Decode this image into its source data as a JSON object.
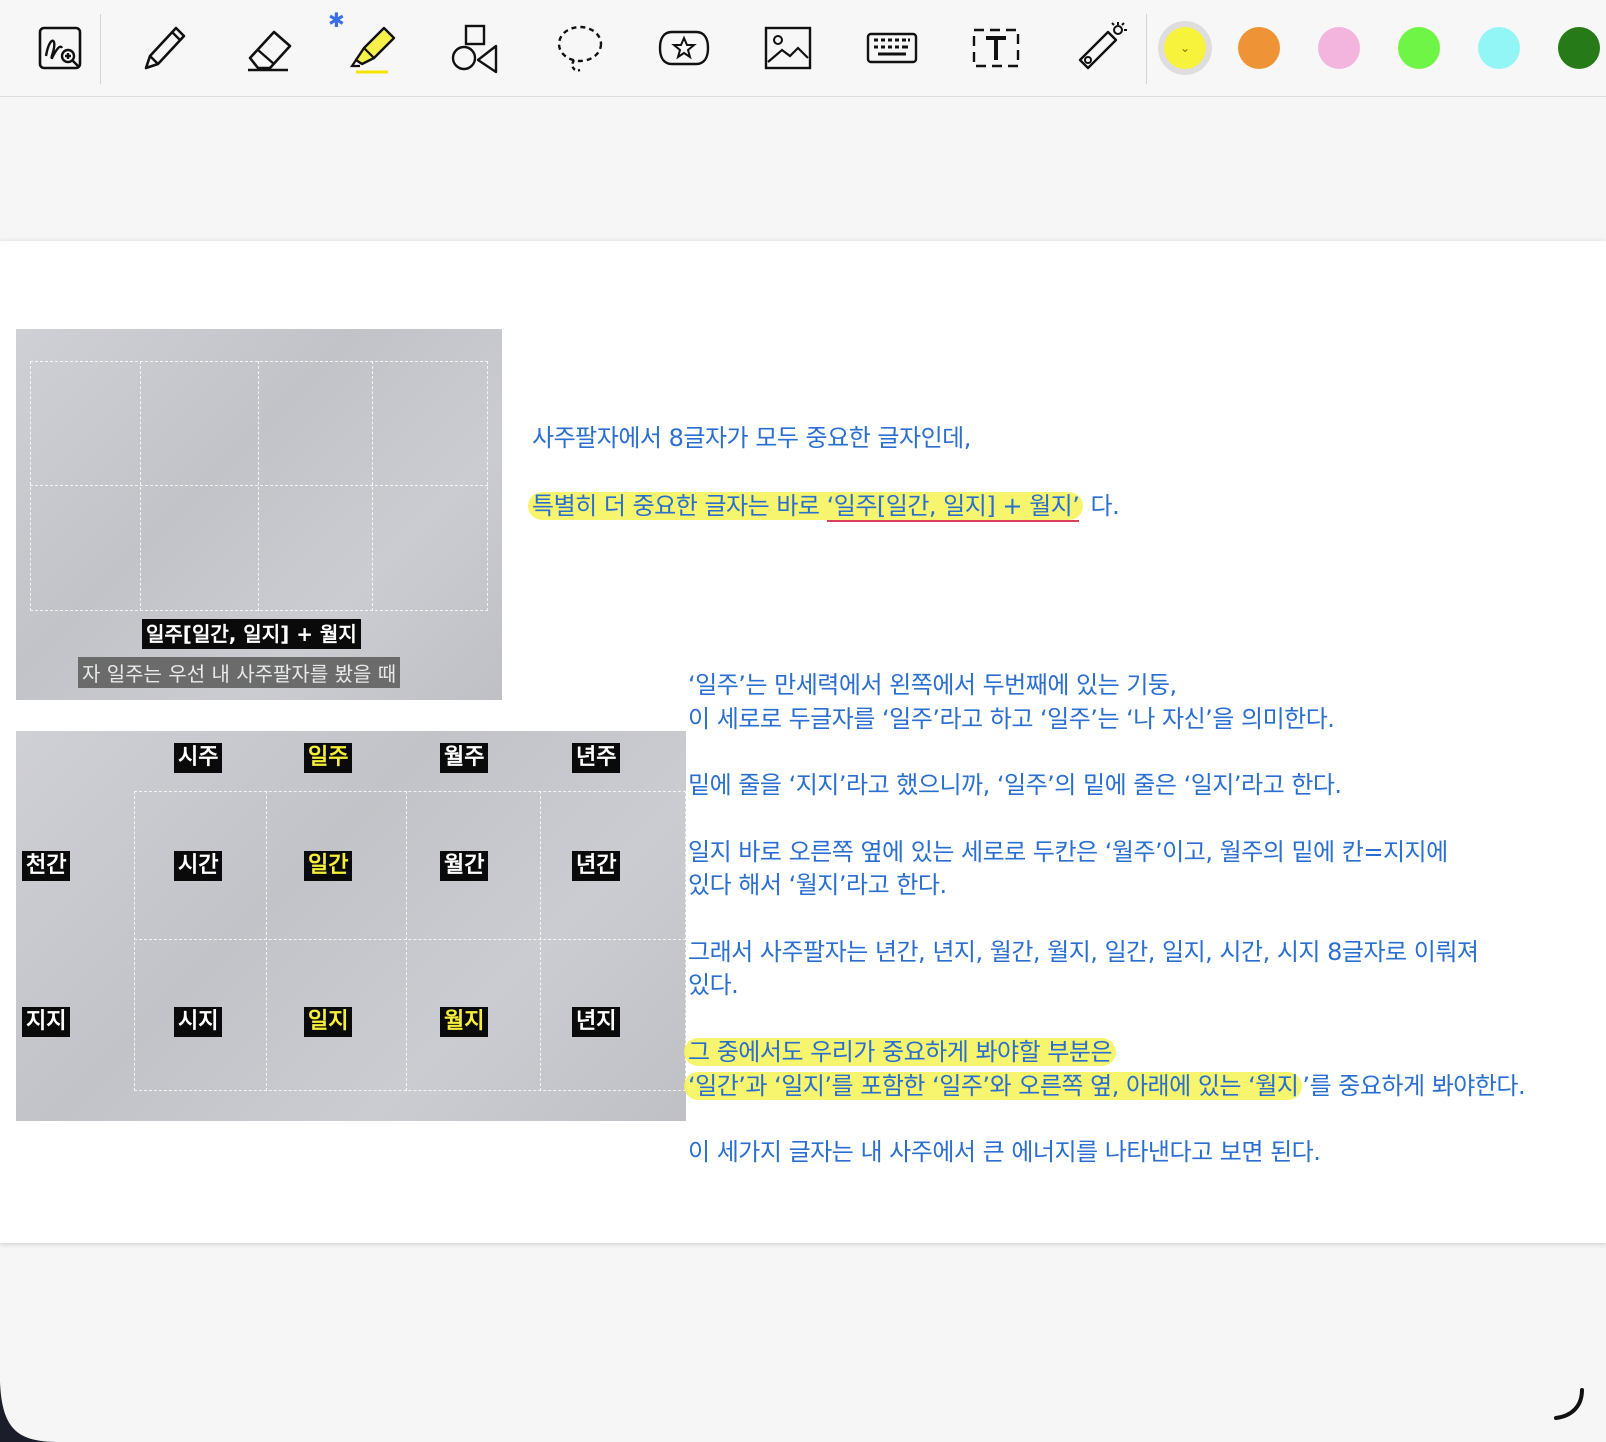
{
  "toolbar": {
    "tools": [
      {
        "name": "zoom-handwriting-icon"
      },
      {
        "name": "pen-icon"
      },
      {
        "name": "eraser-icon"
      },
      {
        "name": "highlighter-icon"
      },
      {
        "name": "shapes-icon"
      },
      {
        "name": "lasso-icon"
      },
      {
        "name": "sticker-icon"
      },
      {
        "name": "image-icon"
      },
      {
        "name": "keyboard-icon"
      },
      {
        "name": "text-box-icon"
      },
      {
        "name": "laser-pointer-icon"
      }
    ],
    "bluetooth_glyph": "✱",
    "colors": [
      {
        "hex": "#f7f23c",
        "selected": true
      },
      {
        "hex": "#ef9436"
      },
      {
        "hex": "#f3b4dd"
      },
      {
        "hex": "#6ef545"
      },
      {
        "hex": "#93f6f6"
      },
      {
        "hex": "#267a18"
      }
    ]
  },
  "image1": {
    "tag_label": "일주[일간, 일지] + 월지",
    "caption": "자 일주는 우선 내 사주팔자를 봤을 때"
  },
  "image2": {
    "columns": [
      "시주",
      "일주",
      "월주",
      "년주"
    ],
    "row_labels": [
      "천간",
      "지지"
    ],
    "heavenly": [
      "시간",
      "일간",
      "월간",
      "년간"
    ],
    "earthly": [
      "시지",
      "일지",
      "월지",
      "년지"
    ]
  },
  "notes": {
    "n1": "사주팔자에서 8글자가 모두 중요한 글자인데,",
    "n2_a": "특별히 더 중요한 글자는 바로 ",
    "n2_b": "‘일주[일간, 일지] + 월지’",
    "n2_c": " 다.",
    "n3": "‘일주’는 만세력에서 왼쪽에서 두번째에 있는 기둥,",
    "n4": "이 세로로 두글자를 ‘일주’라고 하고 ‘일주’는 ‘나 자신’을 의미한다.",
    "n5": "밑에 줄을 ‘지지’라고 했으니까, ‘일주’의 밑에 줄은 ‘일지’라고 한다.",
    "n6": "일지 바로 오른쪽 옆에 있는 세로로 두칸은 ‘월주’이고, 월주의 밑에 칸=지지에",
    "n7": "있다 해서 ‘월지’라고 한다.",
    "n8": "그래서 사주팔자는 년간, 년지, 월간, 월지, 일간, 일지, 시간, 시지 8글자로 이뤄져",
    "n9": "있다.",
    "n10": "그 중에서도 우리가 중요하게 봐야할 부분은",
    "n11_a": "‘일간’과 ‘일지’를 포함한 ‘일주’와 오른쪽 옆, 아래에 있는 ‘월지",
    "n11_b": "’를 중요하게 봐야한다.",
    "n12": "이 세가지 글자는 내 사주에서 큰 에너지를 나타낸다고 보면 된다."
  }
}
